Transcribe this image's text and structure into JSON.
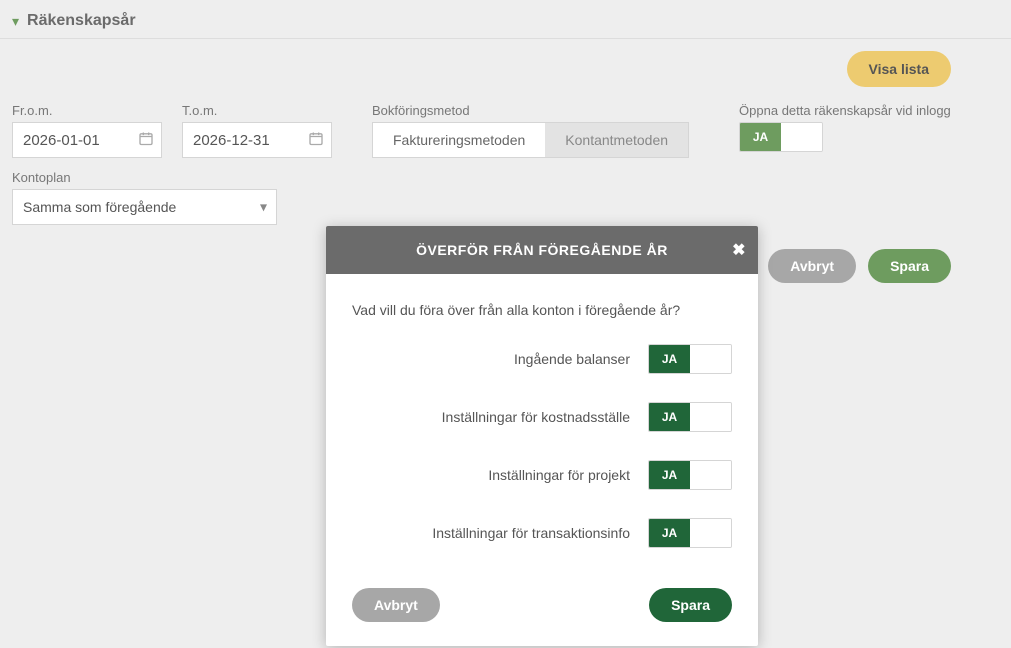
{
  "section": {
    "title": "Räkenskapsår"
  },
  "top_actions": {
    "show_list": "Visa lista"
  },
  "fields": {
    "from": {
      "label": "Fr.o.m.",
      "value": "2026-01-01"
    },
    "to": {
      "label": "T.o.m.",
      "value": "2026-12-31"
    },
    "method": {
      "label": "Bokföringsmetod",
      "option_active": "Faktureringsmetoden",
      "option_inactive": "Kontantmetoden"
    },
    "open_on_login": {
      "label": "Öppna detta räkenskapsår vid inlogg",
      "value": "JA"
    },
    "kontoplan": {
      "label": "Kontoplan",
      "selected": "Samma som föregående"
    }
  },
  "bottom_actions": {
    "cancel": "Avbryt",
    "save": "Spara"
  },
  "modal": {
    "title": "ÖVERFÖR FRÅN FÖREGÅENDE ÅR",
    "question": "Vad vill du föra över från alla konton i föregående år?",
    "options": {
      "balances": {
        "label": "Ingående balanser",
        "value": "JA"
      },
      "cost_centers": {
        "label": "Inställningar för kostnadsställe",
        "value": "JA"
      },
      "projects": {
        "label": "Inställningar för projekt",
        "value": "JA"
      },
      "transaction": {
        "label": "Inställningar för transaktionsinfo",
        "value": "JA"
      }
    },
    "actions": {
      "cancel": "Avbryt",
      "save": "Spara"
    }
  }
}
